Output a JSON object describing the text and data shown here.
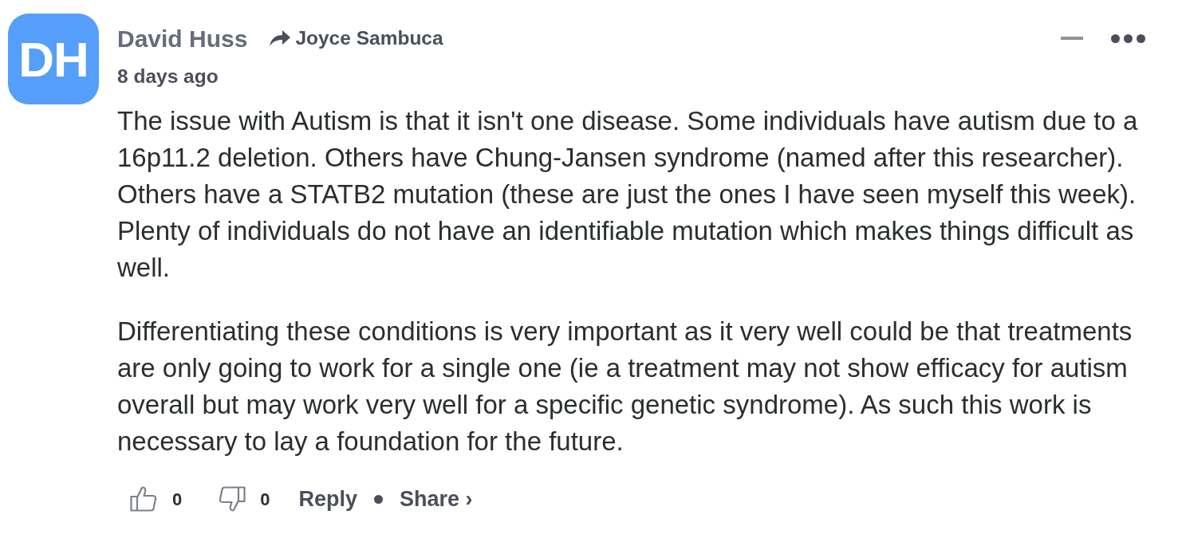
{
  "comment": {
    "avatar": {
      "initials": "DH"
    },
    "author": "David Huss",
    "reply_to": "Joyce Sambuca",
    "time": "8 days ago",
    "paragraphs": [
      "The issue with Autism is that it isn't one disease. Some individuals have autism due to a 16p11.2 deletion. Others have Chung-Jansen syndrome (named after this researcher). Others have a STATB2 mutation (these are just the ones I have seen myself this week). Plenty of individuals do not have an identifiable mutation which makes things difficult as well.",
      "Differentiating these conditions is very important as it very well could be that treatments are only going to work for a single one (ie a treatment may not show efficacy for autism overall but may work very well for a specific genetic syndrome). As such this work is necessary to lay a foundation for the future."
    ],
    "actions": {
      "upvotes": "0",
      "downvotes": "0",
      "reply": "Reply",
      "share": "Share ›"
    }
  }
}
